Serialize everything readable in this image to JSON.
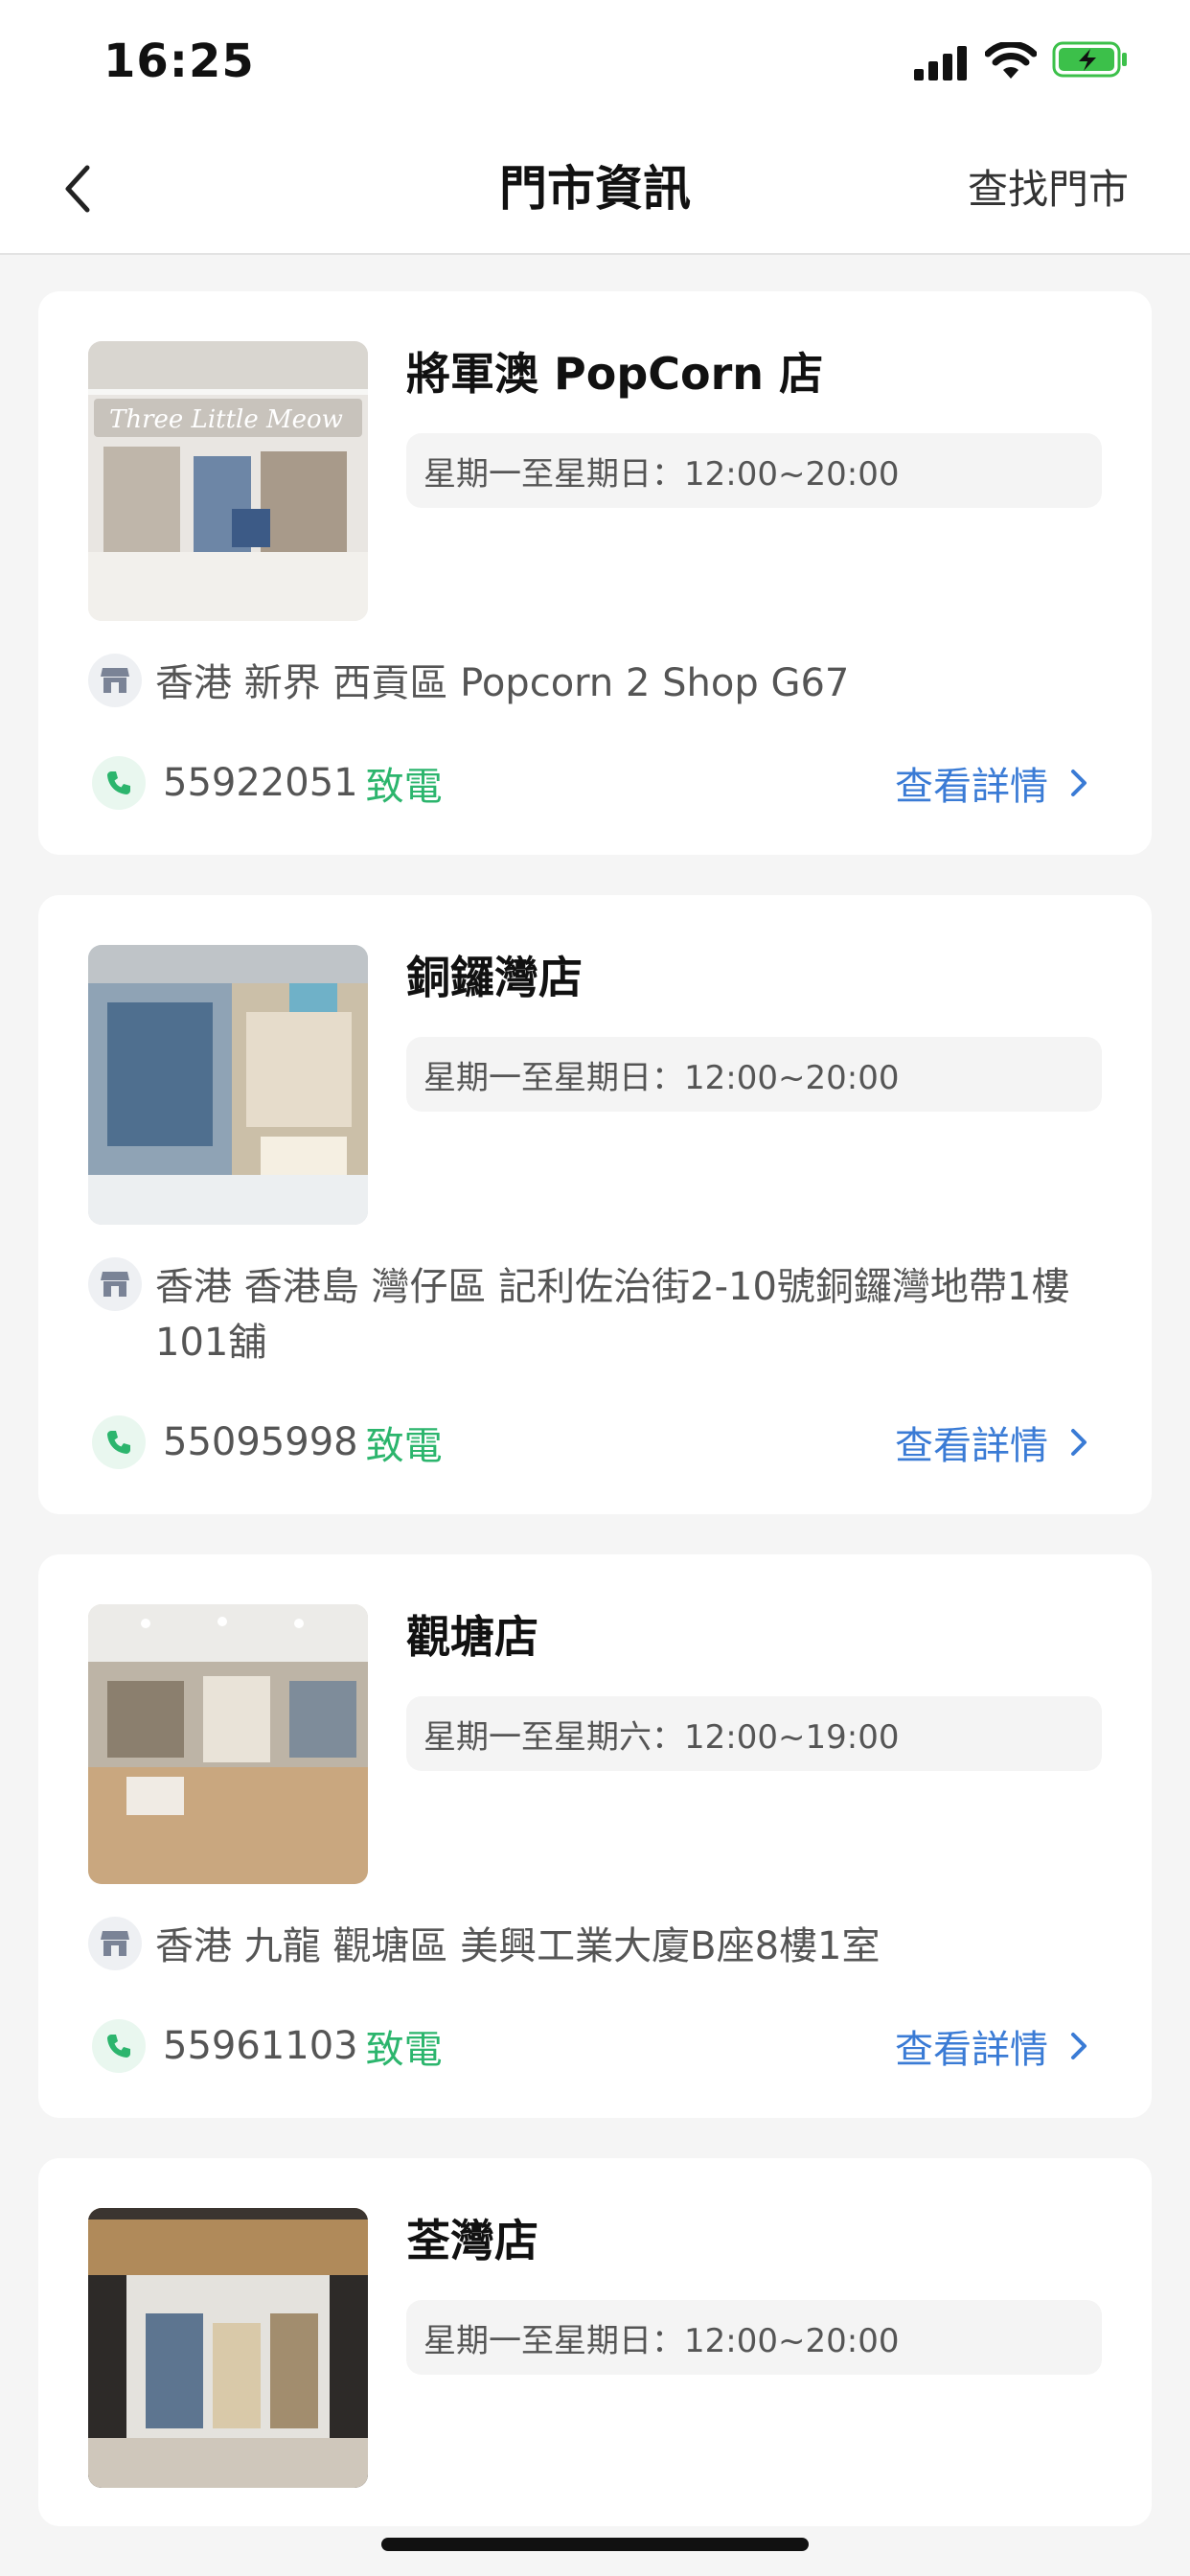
{
  "status_bar": {
    "time": "16:25"
  },
  "nav": {
    "title": "門市資訊",
    "find_store_label": "查找門市",
    "back_icon": "chevron-left-icon"
  },
  "stores": [
    {
      "name": "將軍澳 PopCorn 店",
      "hours": "星期一至星期日：12:00~20:00",
      "address": "香港 新界 西貢區 Popcorn 2 Shop G67",
      "phone": "55922051",
      "call_label": "致電",
      "details_label": "查看詳情"
    },
    {
      "name": "銅鑼灣店",
      "hours": "星期一至星期日：12:00~20:00",
      "address": "香港 香港島 灣仔區 記利佐治街2-10號銅鑼灣地帶1樓101舖",
      "phone": "55095998",
      "call_label": "致電",
      "details_label": "查看詳情"
    },
    {
      "name": "觀塘店",
      "hours": "星期一至星期六：12:00~19:00",
      "address": "香港 九龍 觀塘區 美興工業大廈B座8樓1室",
      "phone": "55961103",
      "call_label": "致電",
      "details_label": "查看詳情"
    },
    {
      "name": "荃灣店",
      "hours": "星期一至星期日：12:00~20:00"
    }
  ],
  "colors": {
    "accent_green": "#2cb56d",
    "link_blue": "#3a7bd5",
    "background": "#f5f5f5"
  }
}
